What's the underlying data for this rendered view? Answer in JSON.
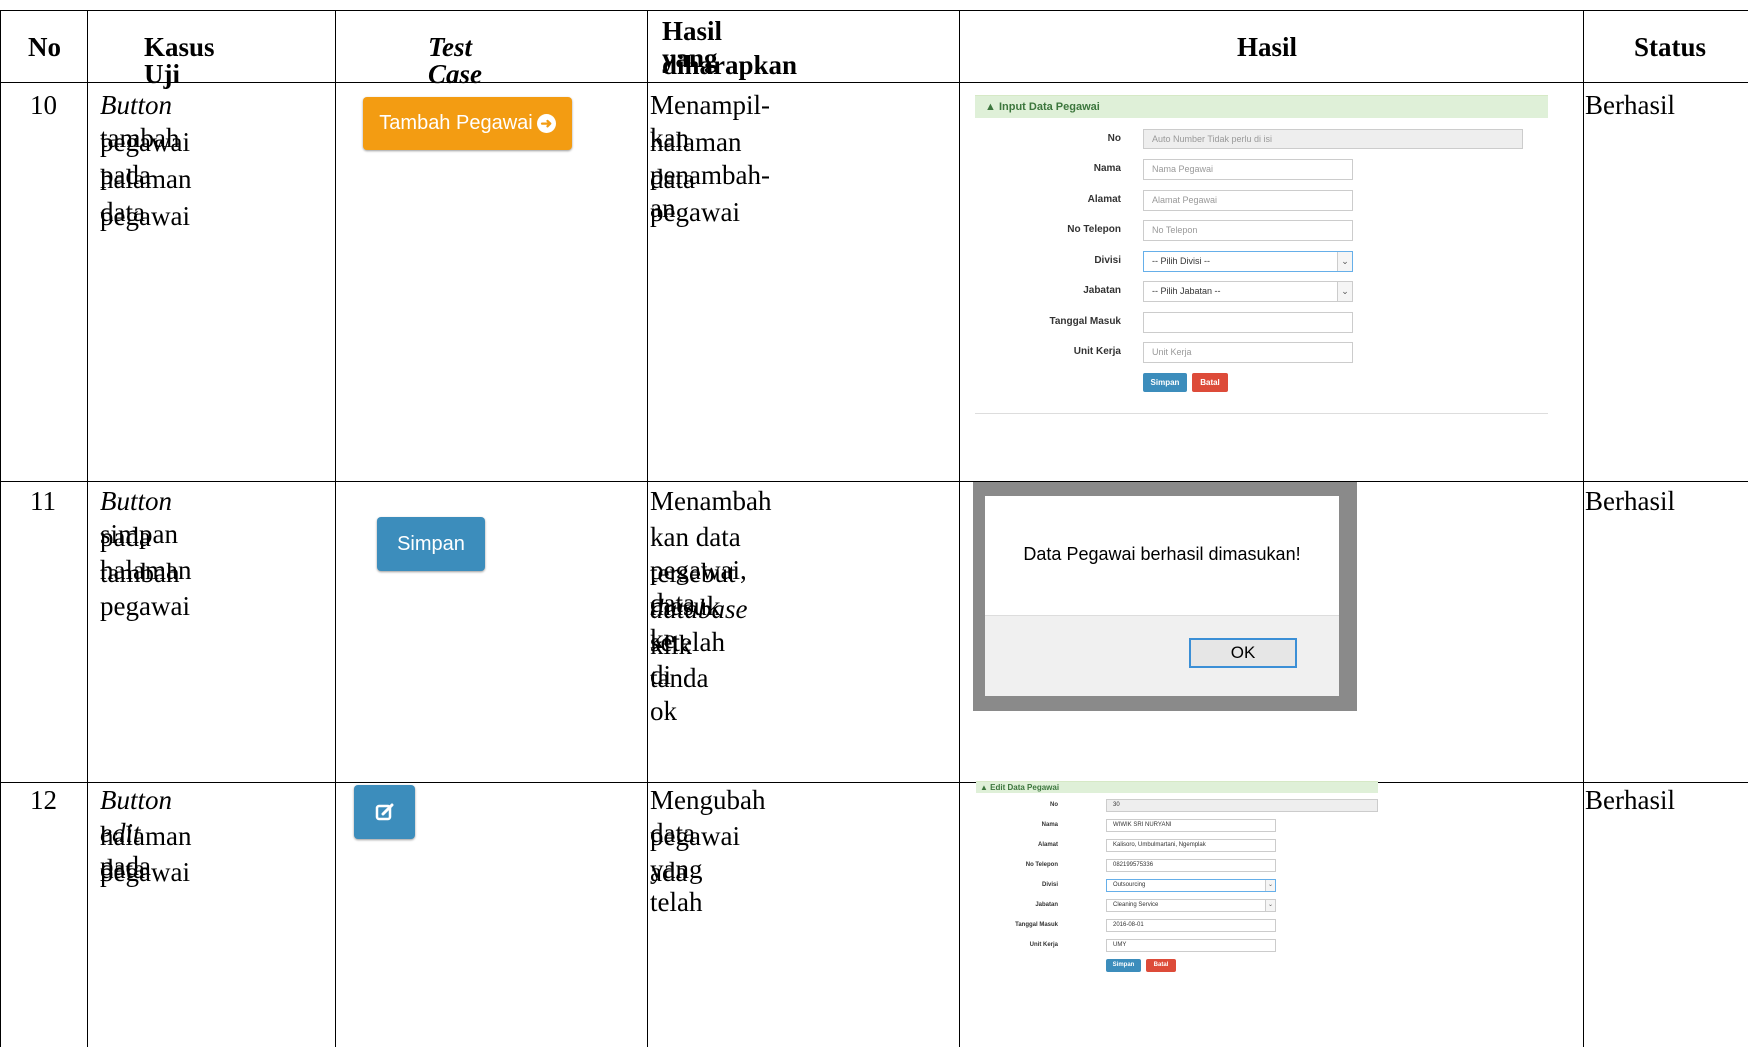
{
  "headers": {
    "no": "No",
    "kasus_uji": "Kasus Uji",
    "test_case": "Test Case",
    "hasil_diharapkan_1": "Hasil yang",
    "hasil_diharapkan_2": "diharapkan",
    "hasil": "Hasil",
    "status": "Status"
  },
  "rows": [
    {
      "no": "10",
      "kasus_em": "Button",
      "kasus_l1": " tambah",
      "kasus_l2": "pegawai pada",
      "kasus_l3": "halaman data",
      "kasus_l4": "pegawai",
      "test_case_button": "Tambah Pegawai",
      "expected_l1": "Menampil-kan",
      "expected_l2": "halaman penambah-an",
      "expected_l3": "data pegawai",
      "status": "Berhasil"
    },
    {
      "no": "11",
      "kasus_em": "Button",
      "kasus_l1": " simpan",
      "kasus_l2": "pada halaman",
      "kasus_l3": "tambah pegawai",
      "test_case_button": "Simpan",
      "expected_l1": "Menambah",
      "expected_l2": "kan data pegawai, data",
      "expected_l3": "tersebut masuk ke",
      "expected_l4_em": "database",
      "expected_l4": " setelah di",
      "expected_l5": "klik tanda ok",
      "status": "Berhasil"
    },
    {
      "no": "12",
      "kasus_em": "Button edit",
      "kasus_l1": " pada",
      "kasus_l2": "halaman data",
      "kasus_l3": "pegawai",
      "expected_l1": "Mengubah data",
      "expected_l2": "pegawai yang telah",
      "expected_l3": "ada",
      "status": "Berhasil"
    }
  ],
  "input_form": {
    "title": "Input Data Pegawai",
    "fields": [
      {
        "label": "No",
        "value": "Auto Number Tidak perlu di isi"
      },
      {
        "label": "Nama",
        "value": "Nama Pegawai"
      },
      {
        "label": "Alamat",
        "value": "Alamat Pegawai"
      },
      {
        "label": "No Telepon",
        "value": "No Telepon"
      },
      {
        "label": "Divisi",
        "value": "-- Pilih Divisi --"
      },
      {
        "label": "Jabatan",
        "value": "-- Pilih Jabatan --"
      },
      {
        "label": "Tanggal Masuk",
        "value": ""
      },
      {
        "label": "Unit Kerja",
        "value": "Unit Kerja"
      }
    ],
    "save": "Simpan",
    "cancel": "Batal"
  },
  "dialog": {
    "message": "Data Pegawai berhasil dimasukan!",
    "ok": "OK"
  },
  "edit_form": {
    "title": "Edit Data Pegawai",
    "fields": [
      {
        "label": "No",
        "value": "30"
      },
      {
        "label": "Nama",
        "value": "WIWIK SRI NURYANI"
      },
      {
        "label": "Alamat",
        "value": "Kalisoro, Umbulmartani, Ngemplak"
      },
      {
        "label": "No Telepon",
        "value": "082199575336"
      },
      {
        "label": "Divisi",
        "value": "Outsourcing"
      },
      {
        "label": "Jabatan",
        "value": "Cleaning Service"
      },
      {
        "label": "Tanggal Masuk",
        "value": "2016-08-01"
      },
      {
        "label": "Unit Kerja",
        "value": "UMY"
      }
    ],
    "save": "Simpan",
    "cancel": "Batal"
  },
  "colors": {
    "orange_button": "#f39c12",
    "blue_button": "#3c8dbc",
    "red_button": "#dd4b39",
    "panel_header": "#dff0d8"
  }
}
